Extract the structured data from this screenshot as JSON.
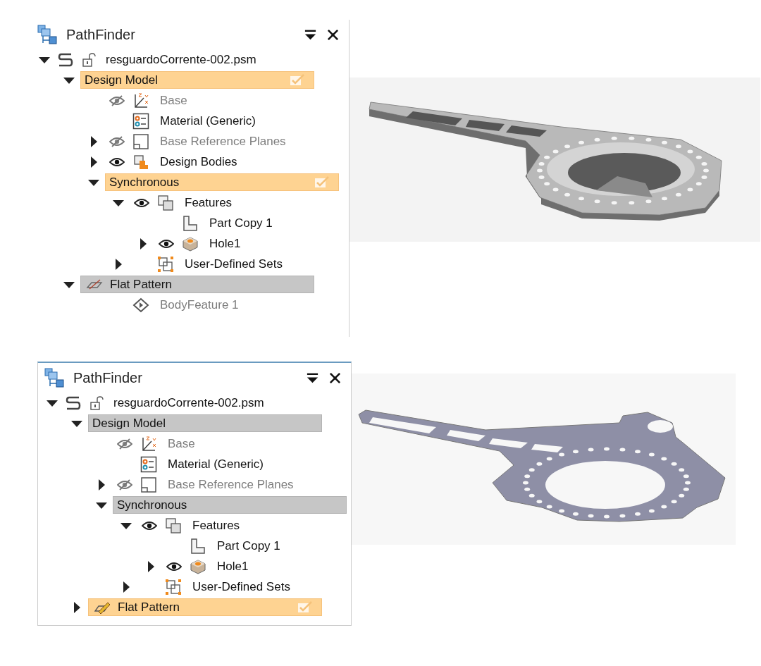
{
  "screenshots": [
    {
      "panel": {
        "title": "PathFinder",
        "tree": [
          {
            "label": "resguardoCorrente-002.psm",
            "kind": "document",
            "expanded": true,
            "children": [
              {
                "label": "Design Model",
                "kind": "environment",
                "active": true,
                "expanded": true,
                "children": [
                  {
                    "label": "Base",
                    "kind": "coord",
                    "visible": false,
                    "dimmed": true
                  },
                  {
                    "label": "Material (Generic)",
                    "kind": "material",
                    "dimmed": false
                  },
                  {
                    "label": "Base Reference Planes",
                    "kind": "planes",
                    "expanded": false,
                    "visible": false,
                    "dimmed": true
                  },
                  {
                    "label": "Design Bodies",
                    "kind": "bodies",
                    "expanded": false,
                    "visible": true,
                    "dimmed": false
                  },
                  {
                    "label": "Synchronous",
                    "kind": "environment",
                    "active": true,
                    "expanded": true,
                    "children": [
                      {
                        "label": "Features",
                        "kind": "features",
                        "expanded": true,
                        "visible": true,
                        "dimmed": false,
                        "children": [
                          {
                            "label": "Part Copy 1",
                            "kind": "partcopy",
                            "dimmed": false
                          },
                          {
                            "label": "Hole1",
                            "kind": "hole",
                            "expanded": false,
                            "visible": true,
                            "dimmed": false
                          }
                        ]
                      },
                      {
                        "label": "User-Defined Sets",
                        "kind": "sets",
                        "expanded": false,
                        "dimmed": false
                      }
                    ]
                  }
                ]
              },
              {
                "label": "Flat Pattern",
                "kind": "flatpattern",
                "active": false,
                "expanded": true,
                "children": [
                  {
                    "label": "BodyFeature 1",
                    "kind": "bodyfeature",
                    "dimmed": true
                  }
                ]
              }
            ]
          }
        ]
      },
      "viewport": {
        "kind": "formed"
      }
    },
    {
      "panel": {
        "title": "PathFinder",
        "tree": [
          {
            "label": "resguardoCorrente-002.psm",
            "kind": "document",
            "expanded": true,
            "children": [
              {
                "label": "Design Model",
                "kind": "environment",
                "active": false,
                "expanded": true,
                "children": [
                  {
                    "label": "Base",
                    "kind": "coord",
                    "visible": false,
                    "dimmed": true
                  },
                  {
                    "label": "Material (Generic)",
                    "kind": "material",
                    "dimmed": false
                  },
                  {
                    "label": "Base Reference Planes",
                    "kind": "planes",
                    "expanded": false,
                    "visible": false,
                    "dimmed": true
                  },
                  {
                    "label": "Synchronous",
                    "kind": "environment",
                    "active": false,
                    "expanded": true,
                    "children": [
                      {
                        "label": "Features",
                        "kind": "features",
                        "expanded": true,
                        "visible": true,
                        "dimmed": false,
                        "children": [
                          {
                            "label": "Part Copy 1",
                            "kind": "partcopy",
                            "dimmed": false
                          },
                          {
                            "label": "Hole1",
                            "kind": "hole",
                            "expanded": false,
                            "visible": true,
                            "dimmed": false
                          }
                        ]
                      },
                      {
                        "label": "User-Defined Sets",
                        "kind": "sets",
                        "expanded": false,
                        "dimmed": false
                      }
                    ]
                  }
                ]
              },
              {
                "label": "Flat Pattern",
                "kind": "flatpattern",
                "active": true,
                "expanded": false
              }
            ]
          }
        ]
      },
      "viewport": {
        "kind": "flat"
      }
    }
  ]
}
